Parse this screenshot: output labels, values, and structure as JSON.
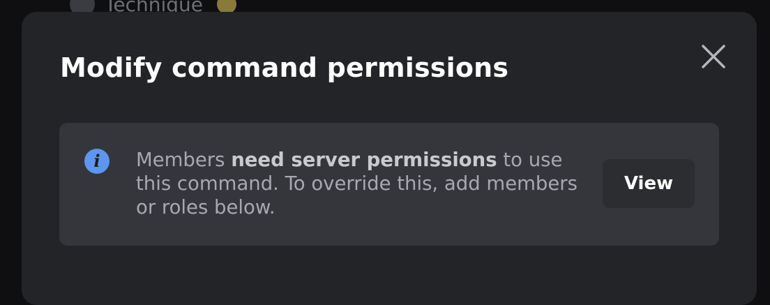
{
  "background": {
    "channel_name": "Technique"
  },
  "modal": {
    "title": "Modify command permissions",
    "close_icon": "close-icon",
    "info": {
      "icon": "info-icon",
      "icon_glyph": "i",
      "text_before": "Members ",
      "text_bold": "need server permissions",
      "text_after": " to use this command. To override this, add members or roles below.",
      "view_label": "View"
    }
  },
  "colors": {
    "modal_bg": "#232428",
    "info_box_bg": "#35363c",
    "info_icon": "#5d96ee",
    "button_bg": "#2b2d31",
    "title": "#ffffff",
    "body_text": "#a8a9b0"
  }
}
